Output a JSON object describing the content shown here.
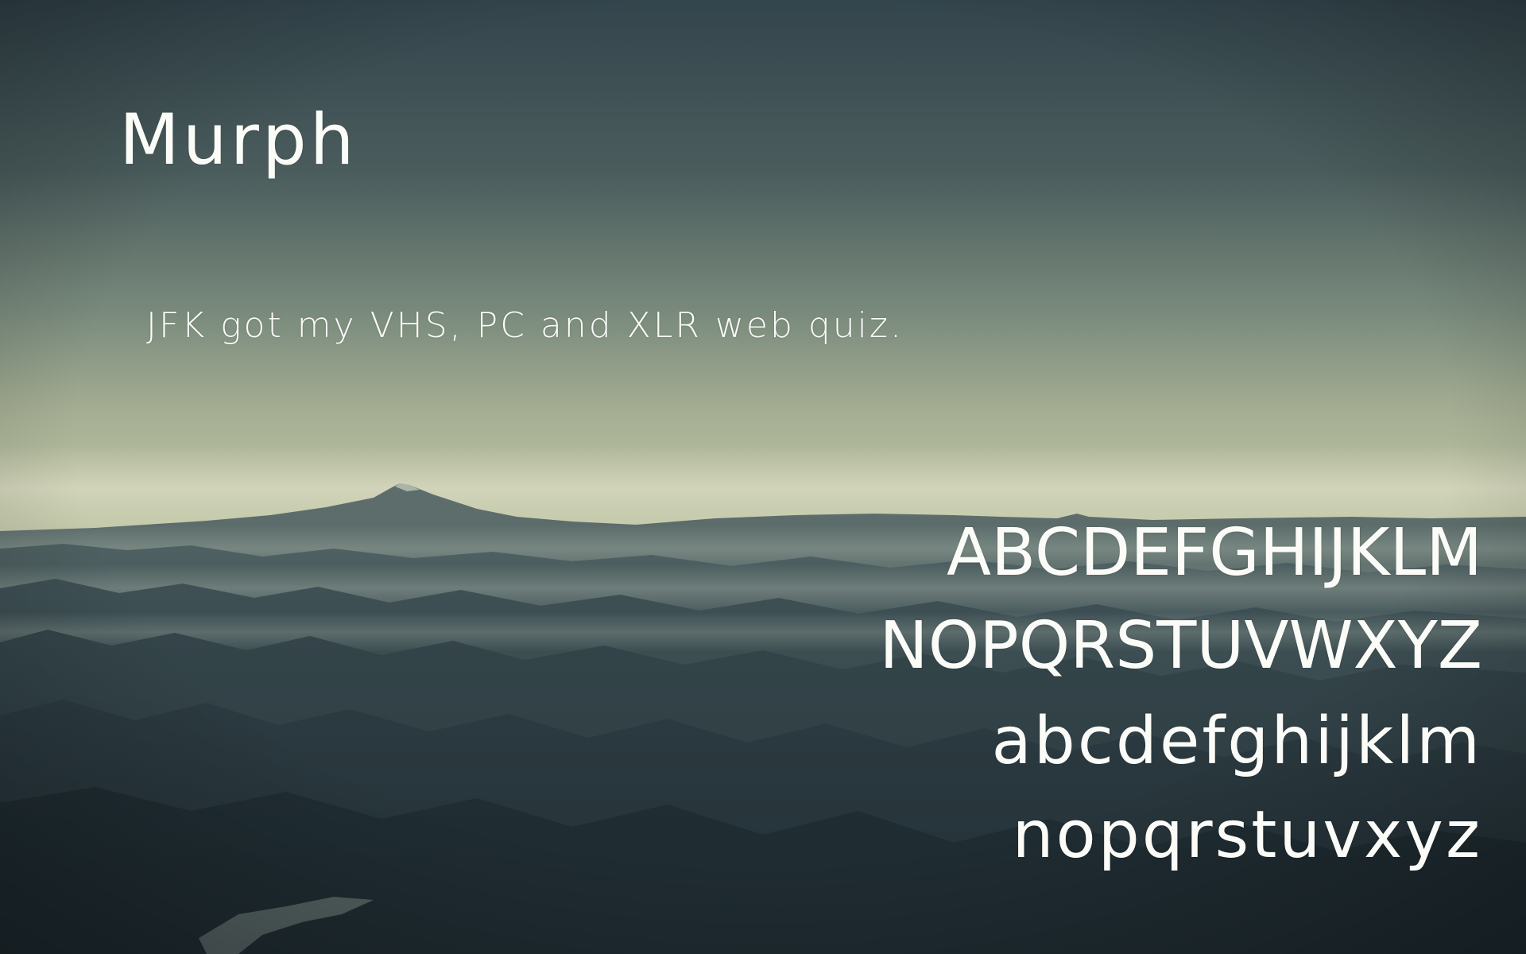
{
  "specimen": {
    "font_name": "Murph",
    "pangram": "JFK got my VHS, PC and XLR web quiz.",
    "alphabet_upper_1": "ABCDEFGHIJKLM",
    "alphabet_upper_2": "NOPQRSTUVWXYZ",
    "alphabet_lower_1": "abcdefghijklm",
    "alphabet_lower_2": "nopqrstuvxyz"
  },
  "colors": {
    "sky_top": "#33454c",
    "sky_horizon": "#c4c9a8",
    "mountains": "#2f3d42",
    "text": "#fbfbf7"
  }
}
